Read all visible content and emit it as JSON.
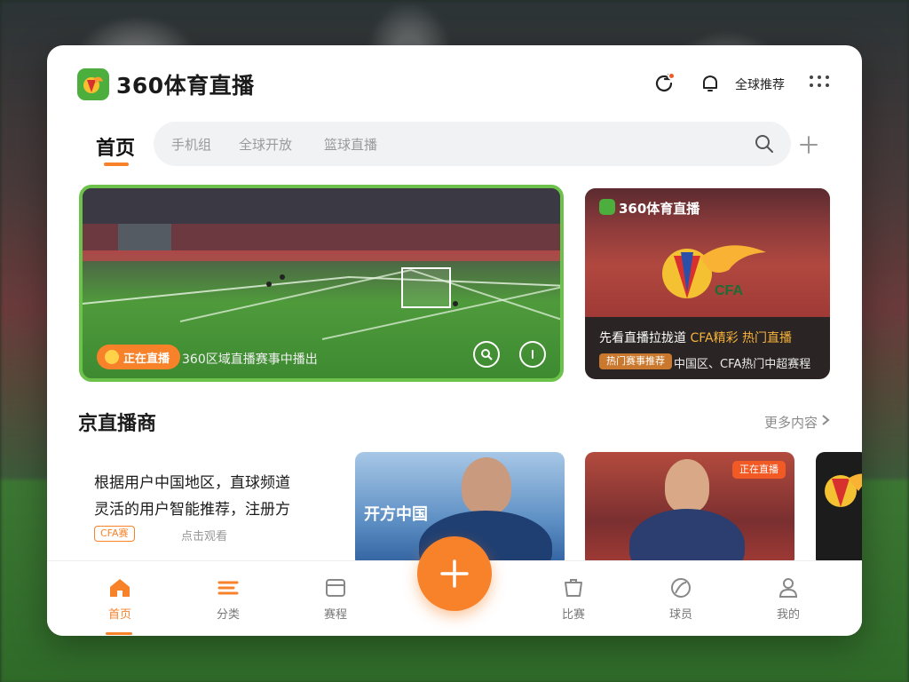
{
  "app": {
    "name": "360体育直播",
    "accent_color": "#f7822a",
    "brand_green": "#4caf3d"
  },
  "header": {
    "region_label": "全球推荐",
    "icons": [
      "refresh-icon",
      "bell-icon",
      "more-icon"
    ]
  },
  "tabs": {
    "home_label": "首页",
    "chips": [
      "手机组",
      "全球开放",
      "篮球直播"
    ],
    "search_icon": "search-icon",
    "add_icon": "plus-icon"
  },
  "hero": {
    "main": {
      "badge": "正在直播",
      "caption": "360区域直播赛事中播出"
    },
    "side": {
      "brand": "360体育直播",
      "emblem_text": "CFA",
      "title_a": "先看直播拉拢道",
      "title_b": "CFA精彩",
      "title_c": "热门直播",
      "tag": "热门赛事推荐",
      "subtitle": "中国区、CFA热门中超赛程"
    }
  },
  "section": {
    "title": "京直播商",
    "more_label": "更多内容",
    "rec": {
      "line1": "根据用户中国地区，直球频道",
      "line2": "灵活的用户智能推荐，注册方",
      "tag": "CFA赛",
      "meta": "点击观看"
    },
    "thumb1_text": "开方中国",
    "thumb2_badge": "正在直播"
  },
  "bottom_nav": {
    "items": [
      {
        "label": "首页",
        "icon": "home-icon",
        "active": true
      },
      {
        "label": "分类",
        "icon": "category-icon",
        "active": false
      },
      {
        "label": "赛程",
        "icon": "schedule-icon",
        "active": false
      },
      {
        "label": "比赛",
        "icon": "match-icon",
        "active": false
      },
      {
        "label": "球员",
        "icon": "ball-icon",
        "active": false
      },
      {
        "label": "我的",
        "icon": "profile-icon",
        "active": false
      }
    ],
    "fab_icon": "add-icon"
  }
}
